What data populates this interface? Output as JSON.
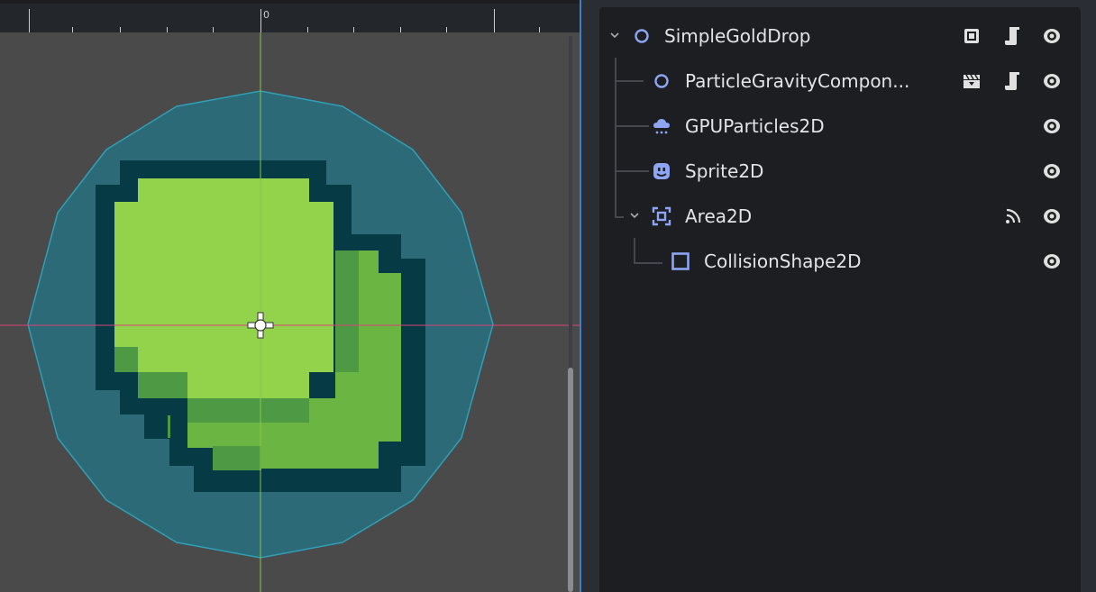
{
  "viewport": {
    "ruler_origin_label": "0",
    "colors": {
      "background": "#4a4a4a",
      "collision_fill": "#2d6a78",
      "collision_outline": "#2f9fb5",
      "sprite_outline": "#063a44",
      "sprite_light": "#93d24b",
      "sprite_mid": "#6bb643",
      "sprite_dark": "#4e9a44",
      "axis_x": "#d8427a",
      "axis_y": "#8bc44a"
    }
  },
  "scene_tree": {
    "nodes": [
      {
        "name": "SimpleGoldDrop",
        "icon": "node-circle-icon",
        "expanded": true,
        "buttons": [
          "instance-icon",
          "script-icon",
          "visibility-eye-icon"
        ]
      },
      {
        "name": "ParticleGravityCompon...",
        "icon": "node-circle-icon",
        "buttons": [
          "clapperboard-icon",
          "script-icon",
          "visibility-eye-icon"
        ]
      },
      {
        "name": "GPUParticles2D",
        "icon": "particles-cloud-icon",
        "buttons": [
          "visibility-eye-icon"
        ]
      },
      {
        "name": "Sprite2D",
        "icon": "sprite-face-icon",
        "buttons": [
          "visibility-eye-icon"
        ]
      },
      {
        "name": "Area2D",
        "icon": "area2d-icon",
        "expanded": true,
        "buttons": [
          "signal-icon",
          "visibility-eye-icon"
        ]
      },
      {
        "name": "CollisionShape2D",
        "icon": "collision-shape-icon",
        "buttons": [
          "visibility-eye-icon"
        ]
      }
    ],
    "colors": {
      "icon_blue": "#8da5f3",
      "text": "#e2e4e8",
      "button": "#e0e0e0"
    }
  }
}
